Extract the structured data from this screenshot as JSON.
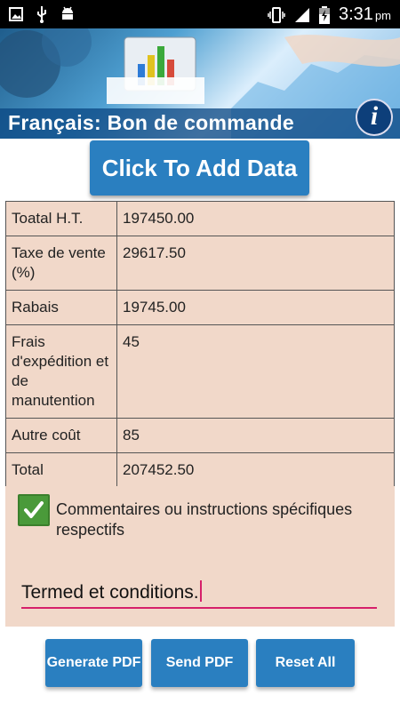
{
  "status_bar": {
    "time": "3:31",
    "ampm": "pm",
    "icons": [
      "image-icon",
      "usb-icon",
      "android-debug-icon",
      "vibrate-icon",
      "signal-icon",
      "battery-charging-icon"
    ]
  },
  "banner": {
    "title": "Français: Bon de commande",
    "info_glyph": "i"
  },
  "add_button": {
    "label": "Click To Add Data"
  },
  "totals": [
    {
      "label": "Toatal H.T.",
      "value": "197450.00"
    },
    {
      "label": "Taxe de vente (%)",
      "value": "29617.50"
    },
    {
      "label": "Rabais",
      "value": "19745.00"
    },
    {
      "label": "Frais d'expédition et de manutention",
      "value": "45"
    },
    {
      "label": "Autre coût",
      "value": "85"
    },
    {
      "label": "Total",
      "value": "207452.50"
    }
  ],
  "comments": {
    "checked": true,
    "label": "Commentaires ou instructions spécifiques respectifs",
    "value": "Termed et conditions."
  },
  "buttons": {
    "generate": "Generate PDF",
    "send": "Send PDF",
    "reset": "Reset All"
  },
  "colors": {
    "accent": "#2a7fc0",
    "panel": "#f1d8c9",
    "checkbox": "#4a9a3a",
    "underline": "#d6206a"
  }
}
